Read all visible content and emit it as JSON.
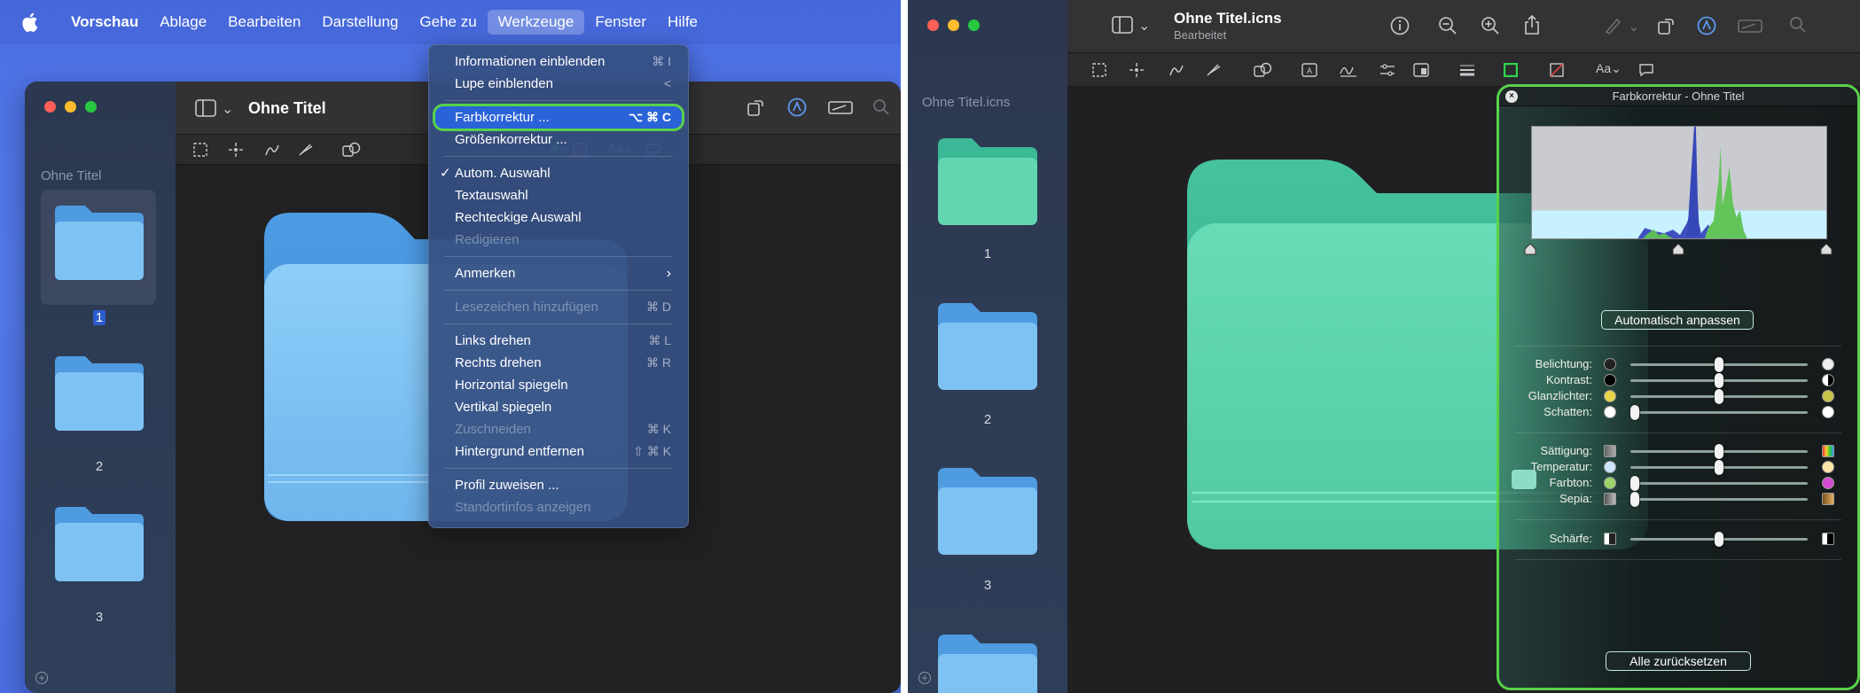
{
  "left": {
    "menubar": {
      "app_name": "Vorschau",
      "items": [
        "Ablage",
        "Bearbeiten",
        "Darstellung",
        "Gehe zu",
        "Werkzeuge",
        "Fenster",
        "Hilfe"
      ],
      "active": "Werkzeuge"
    },
    "window": {
      "title": "Ohne Titel",
      "sidebar_title": "Ohne Titel",
      "pages": [
        "1",
        "2",
        "3"
      ]
    },
    "menu": {
      "items": [
        {
          "label": "Informationen einblenden",
          "shortcut": "⌘ I"
        },
        {
          "label": "Lupe einblenden",
          "shortcut": "<"
        },
        {
          "label": "Farbkorrektur ...",
          "shortcut": "⌥ ⌘ C"
        },
        {
          "label": "Größenkorrektur ...",
          "shortcut": ""
        },
        {
          "label": "Autom. Auswahl",
          "shortcut": "",
          "checked": "✓"
        },
        {
          "label": "Textauswahl",
          "shortcut": ""
        },
        {
          "label": "Rechteckige Auswahl",
          "shortcut": ""
        },
        {
          "label": "Redigieren",
          "shortcut": ""
        },
        {
          "label": "Anmerken",
          "shortcut": "›"
        },
        {
          "label": "Lesezeichen hinzufügen",
          "shortcut": "⌘ D"
        },
        {
          "label": "Links drehen",
          "shortcut": "⌘ L"
        },
        {
          "label": "Rechts drehen",
          "shortcut": "⌘ R"
        },
        {
          "label": "Horizontal spiegeln",
          "shortcut": ""
        },
        {
          "label": "Vertikal spiegeln",
          "shortcut": ""
        },
        {
          "label": "Zuschneiden",
          "shortcut": "⌘ K"
        },
        {
          "label": "Hintergrund entfernen",
          "shortcut": "⇧ ⌘ K"
        },
        {
          "label": "Profil zuweisen ...",
          "shortcut": ""
        },
        {
          "label": "Standortinfos anzeigen",
          "shortcut": ""
        }
      ]
    }
  },
  "right": {
    "window": {
      "title": "Ohne Titel.icns",
      "subtitle": "Bearbeitet",
      "sidebar_title": "Ohne Titel.icns",
      "pages": [
        "1",
        "2",
        "3"
      ]
    },
    "color_panel": {
      "title": "Farbkorrektur - Ohne Titel",
      "auto_button": "Automatisch anpassen",
      "reset_button": "Alle zurücksetzen",
      "sliders": [
        {
          "label": "Belichtung:",
          "value": 0.5
        },
        {
          "label": "Kontrast:",
          "value": 0.5
        },
        {
          "label": "Glanzlichter:",
          "value": 0.5
        },
        {
          "label": "Schatten:",
          "value": 0.0
        },
        {
          "label": "Sättigung:",
          "value": 0.5
        },
        {
          "label": "Temperatur:",
          "value": 0.5
        },
        {
          "label": "Farbton:",
          "value": 0.0
        },
        {
          "label": "Sepia:",
          "value": 0.0
        },
        {
          "label": "Schärfe:",
          "value": 0.5
        }
      ]
    }
  },
  "colors": {
    "highlight_outline": "#58d24a",
    "menu_selection": "#2a62d8",
    "folder_blue": "#7cc0f2",
    "folder_teal": "#5fd3ad"
  }
}
